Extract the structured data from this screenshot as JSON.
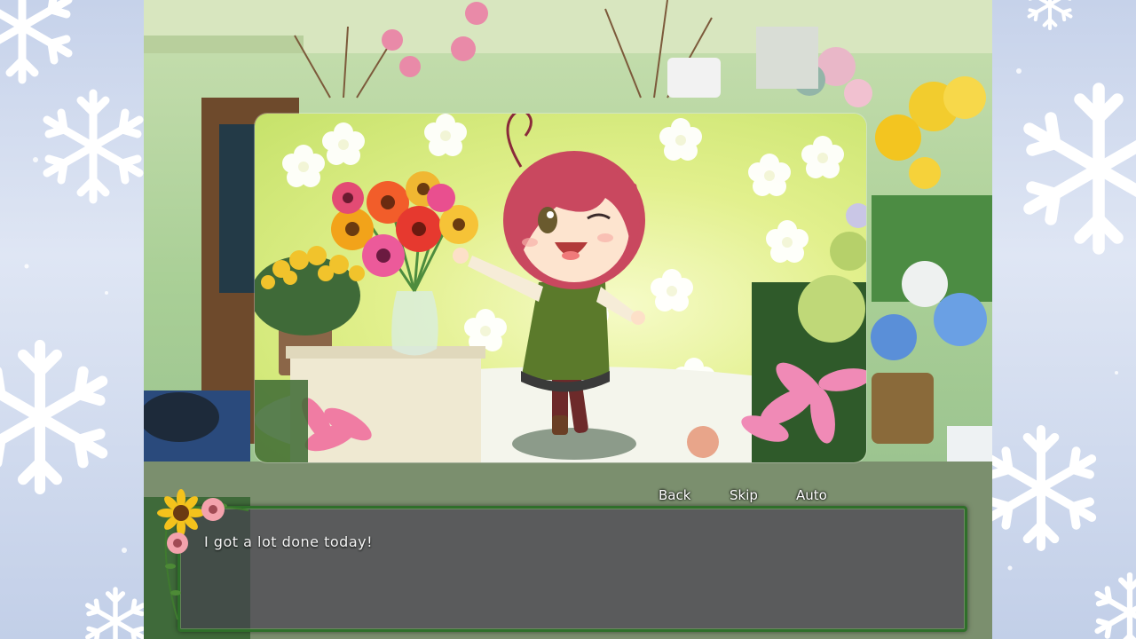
{
  "quick_menu": {
    "back_label": "Back",
    "skip_label": "Skip",
    "auto_label": "Auto"
  },
  "dialogue": {
    "text": "I got a lot done today!"
  },
  "colors": {
    "textbox_border": "#2f6f2a",
    "cg_background": "#e2f08d",
    "hair": "#c9485f",
    "apron": "#5b7a2b"
  },
  "icons": {
    "side_decoration": "snowflake-icon",
    "textbox_decoration": "sunflower-icon"
  }
}
